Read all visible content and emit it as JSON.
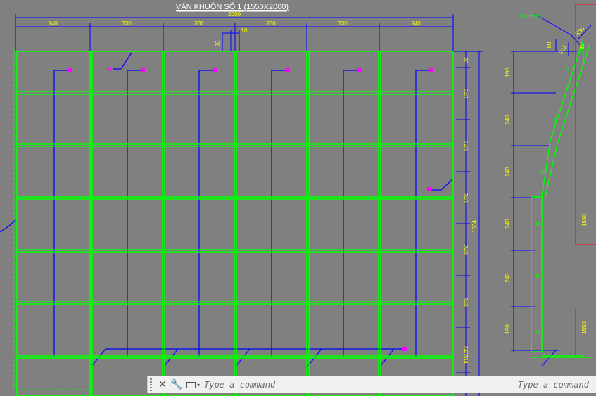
{
  "title": "VÁN KHUÔN SỐ 1 (1550X2000)",
  "dims": {
    "overall_width": "2000",
    "top_segments": [
      "340",
      "330",
      "330",
      "330",
      "330",
      "340"
    ],
    "top_small": "10",
    "left_small": "80",
    "right_segments": [
      "70",
      "240",
      "240",
      "240",
      "240",
      "240",
      "240",
      "204"
    ],
    "right_total": "1604"
  },
  "side_view": {
    "top_note": "Hhh HHH",
    "dim_top_small": "80",
    "dim_top_small2": "80",
    "angle_label": "R30",
    "slope_label": "R11",
    "left_dims": [
      "190",
      "240",
      "240",
      "240",
      "240",
      "190"
    ],
    "red_dims": [
      "1550",
      "1550"
    ]
  },
  "callout_label": "M",
  "command_bar": {
    "close_icon": "close-icon",
    "settings_icon": "wrench-icon",
    "prompt_icon": "command-prompt-icon",
    "placeholder": "Type a command",
    "hint": "Type a command"
  },
  "colors": {
    "background": "#808080",
    "grid": "#00ff00",
    "dimension": "#0000ff",
    "dim_text": "#ffff00",
    "marker": "#ff00ff",
    "section_frame": "#ff0000",
    "command_bar": "#f0f0f0"
  }
}
